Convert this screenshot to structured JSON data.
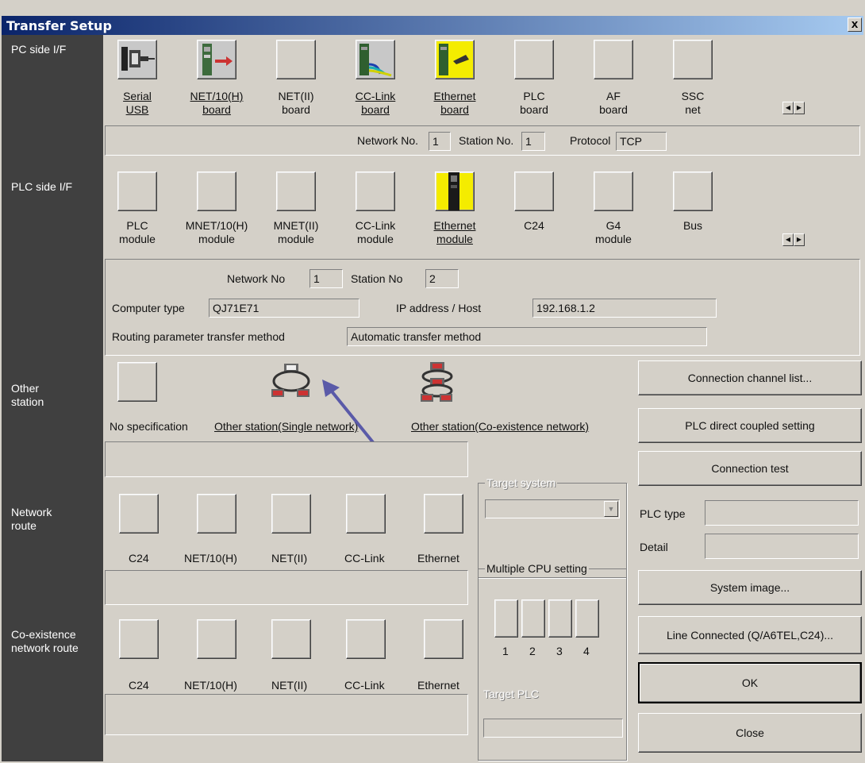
{
  "window": {
    "title": "Transfer Setup",
    "close_glyph": "x"
  },
  "side_labels": {
    "pc_side": "PC side I/F",
    "plc_side": "PLC side I/F",
    "other_station": "Other\nstation",
    "network_route": "Network\nroute",
    "coexistence_route": "Co-existence\nnetwork route"
  },
  "pc_side": {
    "items": [
      {
        "line1": "Serial",
        "line2": "USB",
        "icon": "serial-usb-icon",
        "underline": true
      },
      {
        "line1": "NET/10(H)",
        "line2": "board",
        "icon": "net10h-board-icon",
        "underline": true
      },
      {
        "line1": "NET(II)",
        "line2": "board",
        "icon": "blank-icon",
        "underline": false
      },
      {
        "line1": "CC-Link",
        "line2": "board",
        "icon": "cclink-board-icon",
        "underline": true
      },
      {
        "line1": "Ethernet",
        "line2": "board",
        "icon": "ethernet-board-icon",
        "underline": true
      },
      {
        "line1": "PLC",
        "line2": "board",
        "icon": "blank-icon",
        "underline": false
      },
      {
        "line1": "AF",
        "line2": "board",
        "icon": "blank-icon",
        "underline": false
      },
      {
        "line1": "SSC",
        "line2": "net",
        "icon": "blank-icon",
        "underline": false
      }
    ],
    "network_no_label": "Network No.",
    "network_no": "1",
    "station_no_label": "Station No.",
    "station_no": "1",
    "protocol_label": "Protocol",
    "protocol": "TCP"
  },
  "plc_side": {
    "items": [
      {
        "line1": "PLC",
        "line2": "module",
        "underline": false
      },
      {
        "line1": "MNET/10(H)",
        "line2": "module",
        "underline": false
      },
      {
        "line1": "MNET(II)",
        "line2": "module",
        "underline": false
      },
      {
        "line1": "CC-Link",
        "line2": "module",
        "underline": false
      },
      {
        "line1": "Ethernet",
        "line2": "module",
        "underline": true
      },
      {
        "line1": "C24",
        "line2": "",
        "underline": false
      },
      {
        "line1": "G4",
        "line2": "module",
        "underline": false
      },
      {
        "line1": "Bus",
        "line2": "",
        "underline": false
      }
    ],
    "network_no_label": "Network No",
    "network_no": "1",
    "station_no_label": "Station No",
    "station_no": "2",
    "computer_type_label": "Computer type",
    "computer_type": "QJ71E71",
    "ip_label": "IP address / Host",
    "ip": "192.168.1.2",
    "routing_label": "Routing parameter transfer method",
    "routing": "Automatic transfer method"
  },
  "other_station": {
    "no_spec": "No specification",
    "single": "Other station(Single network)",
    "coexist": "Other station(Co-existence network)"
  },
  "network_route": {
    "items": [
      "C24",
      "NET/10(H)",
      "NET(II)",
      "CC-Link",
      "Ethernet"
    ]
  },
  "coexistence_route": {
    "items": [
      "C24",
      "NET/10(H)",
      "NET(II)",
      "CC-Link",
      "Ethernet"
    ]
  },
  "target_system": {
    "title": "Target system"
  },
  "multiple_cpu": {
    "title": "Multiple CPU setting",
    "numbers": [
      "1",
      "2",
      "3",
      "4"
    ],
    "target_plc": "Target PLC"
  },
  "buttons": {
    "connection_channel": "Connection  channel  list...",
    "plc_direct": "PLC direct coupled setting",
    "connection_test": "Connection test",
    "system_image": "System   image...",
    "line_connected": "Line Connected (Q/A6TEL,C24)...",
    "ok": "OK",
    "close": "Close"
  },
  "plc_type_label": "PLC type",
  "detail_label": "Detail",
  "colors": {
    "title_bar": "#0a246a",
    "dialog_bg": "#d4d0c8",
    "side_panel": "#404040",
    "arrow": "#5a5aa8",
    "ethernet_icon": "#f4ec00"
  }
}
